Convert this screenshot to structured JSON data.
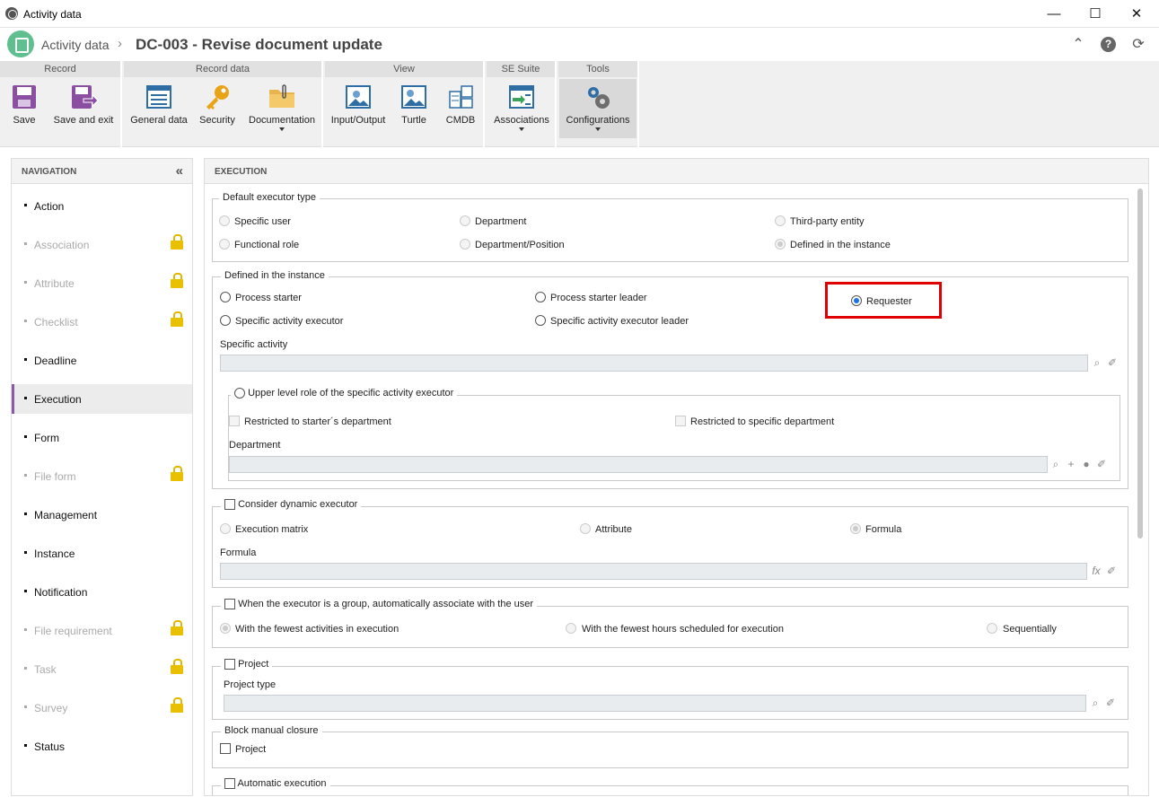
{
  "window": {
    "title": "Activity data",
    "minimize": "—",
    "maximize": "☐",
    "close": "✕"
  },
  "header": {
    "breadcrumb": "Activity data",
    "separator": "›",
    "document_title": "DC-003 - Revise document update"
  },
  "toolbar": {
    "groups": {
      "record": "Record",
      "record_data": "Record data",
      "view": "View",
      "se_suite": "SE Suite",
      "tools": "Tools"
    },
    "buttons": {
      "save": "Save",
      "save_exit": "Save and exit",
      "general_data": "General data",
      "security": "Security",
      "documentation": "Documentation",
      "input_output": "Input/Output",
      "turtle": "Turtle",
      "cmdb": "CMDB",
      "associations": "Associations",
      "configurations": "Configurations"
    }
  },
  "nav": {
    "title": "NAVIGATION",
    "items": [
      {
        "label": "Action",
        "disabled": false,
        "locked": false
      },
      {
        "label": "Association",
        "disabled": true,
        "locked": true
      },
      {
        "label": "Attribute",
        "disabled": true,
        "locked": true
      },
      {
        "label": "Checklist",
        "disabled": true,
        "locked": true
      },
      {
        "label": "Deadline",
        "disabled": false,
        "locked": false
      },
      {
        "label": "Execution",
        "disabled": false,
        "locked": false,
        "selected": true
      },
      {
        "label": "Form",
        "disabled": false,
        "locked": false
      },
      {
        "label": "File form",
        "disabled": true,
        "locked": true
      },
      {
        "label": "Management",
        "disabled": false,
        "locked": false
      },
      {
        "label": "Instance",
        "disabled": false,
        "locked": false
      },
      {
        "label": "Notification",
        "disabled": false,
        "locked": false
      },
      {
        "label": "File requirement",
        "disabled": true,
        "locked": true
      },
      {
        "label": "Task",
        "disabled": true,
        "locked": true
      },
      {
        "label": "Survey",
        "disabled": true,
        "locked": true
      },
      {
        "label": "Status",
        "disabled": false,
        "locked": false
      }
    ]
  },
  "execution": {
    "title": "EXECUTION",
    "default_executor": {
      "legend": "Default executor type",
      "specific_user": "Specific user",
      "department": "Department",
      "third_party": "Third-party entity",
      "functional_role": "Functional role",
      "department_position": "Department/Position",
      "defined_instance": "Defined in the instance"
    },
    "defined_instance": {
      "legend": "Defined in the instance",
      "process_starter": "Process starter",
      "process_starter_leader": "Process starter leader",
      "requester": "Requester",
      "specific_activity_executor": "Specific activity executor",
      "specific_activity_executor_leader": "Specific activity executor leader",
      "specific_activity_label": "Specific activity",
      "upper_level": {
        "legend": "Upper level role of the specific activity executor",
        "restricted_starter": "Restricted to starter´s department",
        "restricted_specific": "Restricted to specific department",
        "department_label": "Department"
      }
    },
    "dynamic": {
      "legend": "Consider dynamic executor",
      "execution_matrix": "Execution matrix",
      "attribute": "Attribute",
      "formula": "Formula",
      "formula_label": "Formula"
    },
    "group": {
      "legend": "When the executor is a group, automatically associate with the user",
      "fewest_activities": "With the fewest activities in execution",
      "fewest_hours": "With the fewest hours scheduled for execution",
      "sequentially": "Sequentially"
    },
    "project": {
      "legend": "Project",
      "project_type_label": "Project type"
    },
    "block_manual": {
      "legend": "Block manual closure",
      "project": "Project"
    },
    "automatic": {
      "legend": "Automatic execution"
    }
  },
  "colors": {
    "accent": "#8a5aa6",
    "radio_selected": "#1a73e8",
    "highlight": "#e00000",
    "lock": "#e8c000"
  }
}
